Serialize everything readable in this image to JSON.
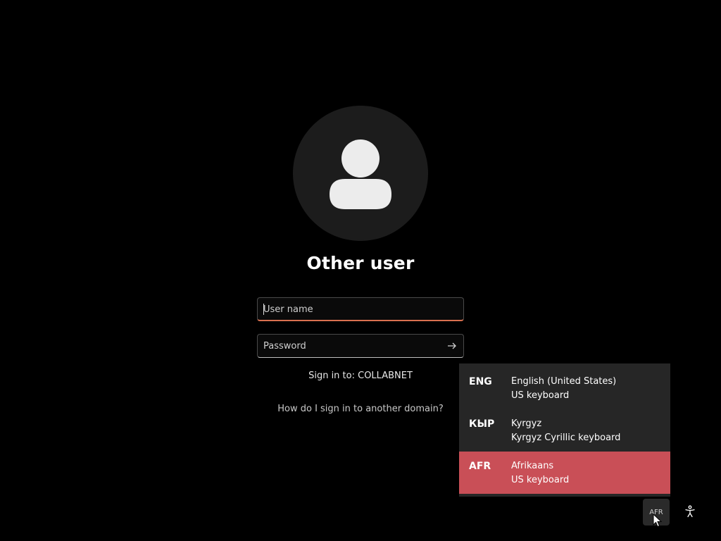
{
  "user": {
    "title": "Other user",
    "avatar_icon": "person-icon"
  },
  "form": {
    "username_placeholder": "User name",
    "username_value": "",
    "password_placeholder": "Password",
    "password_value": "",
    "submit_icon": "arrow-right-icon",
    "sign_in_to": "Sign in to: COLLABNET",
    "domain_link": "How do I sign in to another domain?"
  },
  "language_menu": {
    "items": [
      {
        "code": "ENG",
        "name": "English (United States)",
        "keyboard": "US keyboard",
        "selected": false
      },
      {
        "code": "КЫР",
        "name": "Kyrgyz",
        "keyboard": "Kyrgyz Cyrillic keyboard",
        "selected": false
      },
      {
        "code": "AFR",
        "name": "Afrikaans",
        "keyboard": "US keyboard",
        "selected": true
      }
    ],
    "highlight_color": "#c94f57",
    "background_color": "#262626"
  },
  "tray": {
    "language_indicator": "AFR",
    "accessibility_icon": "accessibility-icon"
  },
  "colors": {
    "background": "#000000",
    "input_focus_accent": "#d9704f"
  }
}
